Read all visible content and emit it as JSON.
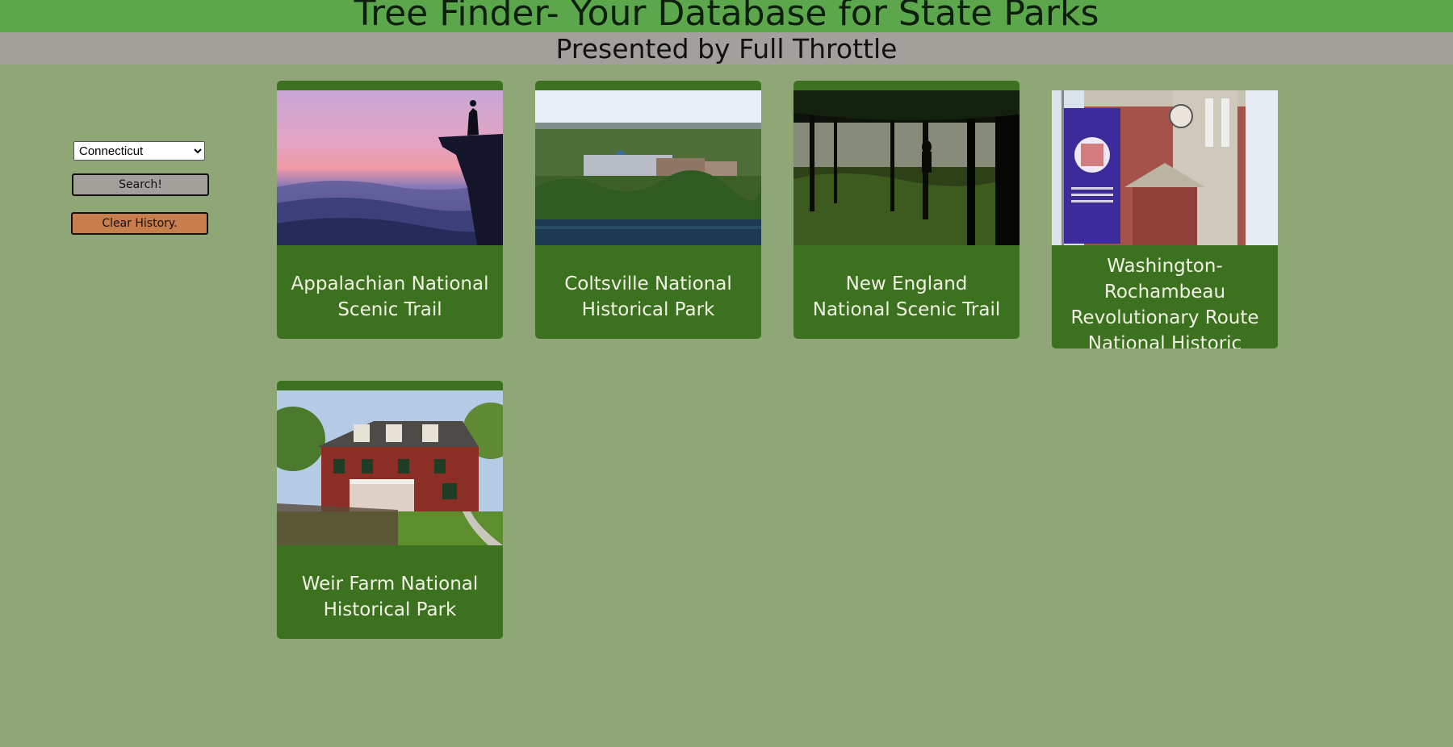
{
  "header": {
    "title": "Tree Finder- Your Database for State Parks",
    "subtitle": "Presented by Full Throttle"
  },
  "sidebar": {
    "state_select": {
      "value": "Connecticut",
      "options": [
        "Connecticut"
      ]
    },
    "search_label": "Search!",
    "clear_label": "Clear History."
  },
  "parks": [
    {
      "name": "Appalachian National Scenic Trail",
      "image": "mountain-sunset-hiker"
    },
    {
      "name": "Coltsville National Historical Park",
      "image": "town-river-view"
    },
    {
      "name": "New England National Scenic Trail",
      "image": "forest-silhouette"
    },
    {
      "name": "Washington-Rochambeau Revolutionary Route National Historic Trail",
      "image": "banner-on-building"
    },
    {
      "name": "Weir Farm National Historical Park",
      "image": "red-farmhouse"
    }
  ],
  "colors": {
    "background": "#8fa677",
    "title_bar": "#5ca64c",
    "subtitle_bar": "#a3a09b",
    "card": "#3c721f",
    "clear_button": "#c87d4d"
  }
}
